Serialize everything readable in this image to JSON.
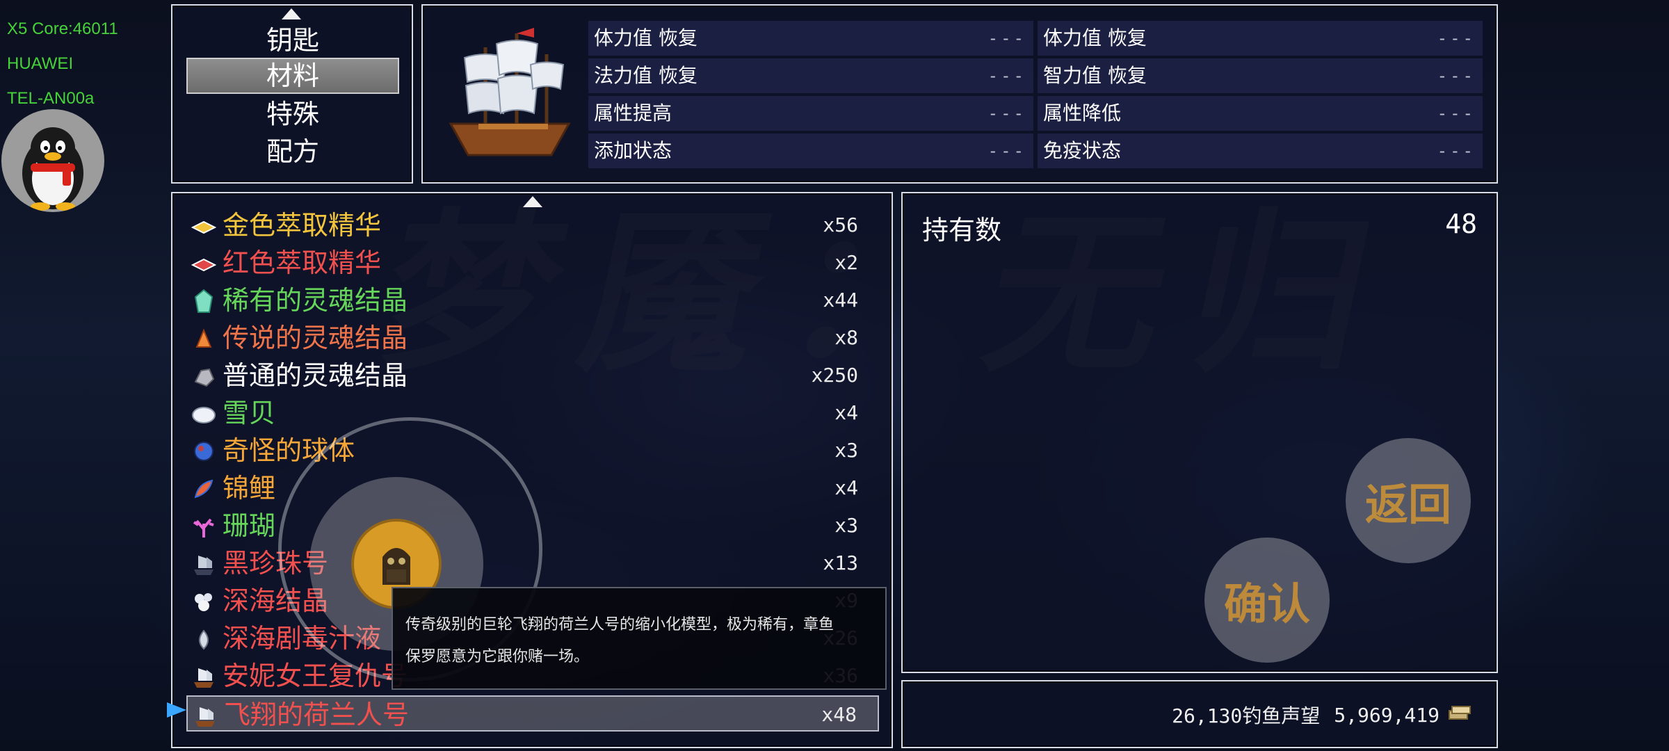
{
  "system": {
    "core": "X5 Core:46011",
    "brand": "HUAWEI",
    "model": "TEL-AN00a"
  },
  "categories": {
    "items": [
      "钥匙",
      "材料",
      "特殊",
      "配方"
    ],
    "selected": "材料"
  },
  "status_effects": {
    "left": [
      {
        "label": "体力值 恢复",
        "value": "---"
      },
      {
        "label": "法力值 恢复",
        "value": "---"
      },
      {
        "label": "属性提高",
        "value": "---"
      },
      {
        "label": "添加状态",
        "value": "---"
      }
    ],
    "right": [
      {
        "label": "体力值 恢复",
        "value": "---"
      },
      {
        "label": "智力值 恢复",
        "value": "---"
      },
      {
        "label": "属性降低",
        "value": "---"
      },
      {
        "label": "免疫状态",
        "value": "---"
      }
    ]
  },
  "items": [
    {
      "name": "金色萃取精华",
      "qty": "x56",
      "color": "#f3c53c",
      "icon": "gold-essence-icon"
    },
    {
      "name": "红色萃取精华",
      "qty": "x2",
      "color": "#f0504e",
      "icon": "red-essence-icon"
    },
    {
      "name": "稀有的灵魂结晶",
      "qty": "x44",
      "color": "#66d65a",
      "icon": "rare-crystal-icon"
    },
    {
      "name": "传说的灵魂结晶",
      "qty": "x8",
      "color": "#f0744a",
      "icon": "legend-crystal-icon"
    },
    {
      "name": "普通的灵魂结晶",
      "qty": "x250",
      "color": "#ffffff",
      "icon": "common-crystal-icon"
    },
    {
      "name": "雪贝",
      "qty": "x4",
      "color": "#66d65a",
      "icon": "shell-icon"
    },
    {
      "name": "奇怪的球体",
      "qty": "x3",
      "color": "#f3c53c",
      "icon": "orb-icon"
    },
    {
      "name": "锦鲤",
      "qty": "x4",
      "color": "#f3c53c",
      "icon": "koi-icon"
    },
    {
      "name": "珊瑚",
      "qty": "x3",
      "color": "#66d65a",
      "icon": "coral-icon"
    },
    {
      "name": "黑珍珠号",
      "qty": "x13",
      "color": "#f0504e",
      "icon": "ship-icon"
    },
    {
      "name": "深海结晶",
      "qty": "x9",
      "color": "#f0504e",
      "icon": "deep-crystal-icon"
    },
    {
      "name": "深海剧毒汁液",
      "qty": "x26",
      "color": "#f0504e",
      "icon": "venom-icon"
    },
    {
      "name": "安妮女王复仇号",
      "qty": "x36",
      "color": "#f0504e",
      "icon": "ship-icon"
    },
    {
      "name": "飞翔的荷兰人号",
      "qty": "x48",
      "color": "#f0504e",
      "icon": "ship-icon"
    }
  ],
  "selected_index": 13,
  "possession": {
    "label": "持有数",
    "value": "48"
  },
  "tooltip": {
    "line1": "传奇级别的巨轮飞翔的荷兰人号的缩小化模型，极为稀有，章鱼",
    "line2": "保罗愿意为它跟你赌一场。"
  },
  "currency": {
    "fame": "26,130钓鱼声望",
    "gold": "5,969,419"
  },
  "buttons": {
    "back": "返回",
    "confirm": "确认"
  },
  "background_title": "梦魇：无归"
}
